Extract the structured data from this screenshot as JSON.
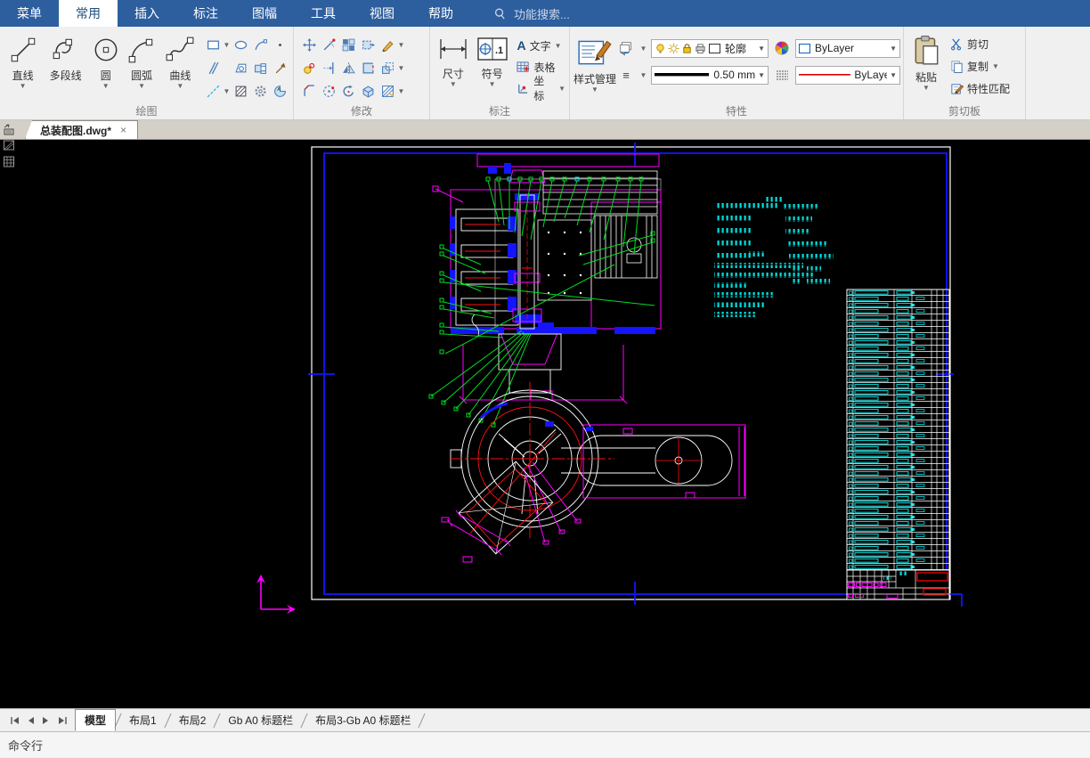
{
  "menubar": {
    "items": [
      {
        "label": "菜单"
      },
      {
        "label": "常用",
        "active": true
      },
      {
        "label": "插入"
      },
      {
        "label": "标注"
      },
      {
        "label": "图幅"
      },
      {
        "label": "工具"
      },
      {
        "label": "视图"
      },
      {
        "label": "帮助"
      }
    ],
    "search_placeholder": "功能搜索..."
  },
  "ribbon": {
    "draw": {
      "label": "绘图",
      "buttons": [
        {
          "label": "直线"
        },
        {
          "label": "多段线"
        },
        {
          "label": "圆"
        },
        {
          "label": "圆弧"
        },
        {
          "label": "曲线"
        }
      ]
    },
    "modify": {
      "label": "修改"
    },
    "annotate": {
      "label": "标注",
      "dimension": "尺寸",
      "symbol": "符号",
      "text": "文字",
      "table": "表格",
      "coordinate": "坐标"
    },
    "properties": {
      "label": "特性",
      "style_manager": "样式管理",
      "layer_value": "轮廓",
      "lineweight_value": "0.50 mm",
      "color_value": "ByLayer",
      "linetype_value": "ByLayer"
    },
    "clipboard": {
      "label": "剪切板",
      "paste": "粘贴",
      "cut": "剪切",
      "copy": "复制",
      "match": "特性匹配"
    }
  },
  "document_tab": {
    "title": "总装配图.dwg*",
    "close": "×"
  },
  "layout_tabs": {
    "items": [
      {
        "label": "模型",
        "active": true
      },
      {
        "label": "布局1"
      },
      {
        "label": "布局2"
      },
      {
        "label": "Gb A0 标题栏"
      },
      {
        "label": "布局3-Gb A0 标题栏"
      }
    ]
  },
  "command_line": {
    "prompt": "命令行"
  },
  "canvas_colors": {
    "background": "#000000",
    "frame_blue": "#1414ff",
    "paper_white": "#ffffff",
    "geometry_magenta": "#ff00ff",
    "leader_green": "#00dd22",
    "text_cyan": "#00e0e0",
    "centerline_red": "#ff1111"
  }
}
